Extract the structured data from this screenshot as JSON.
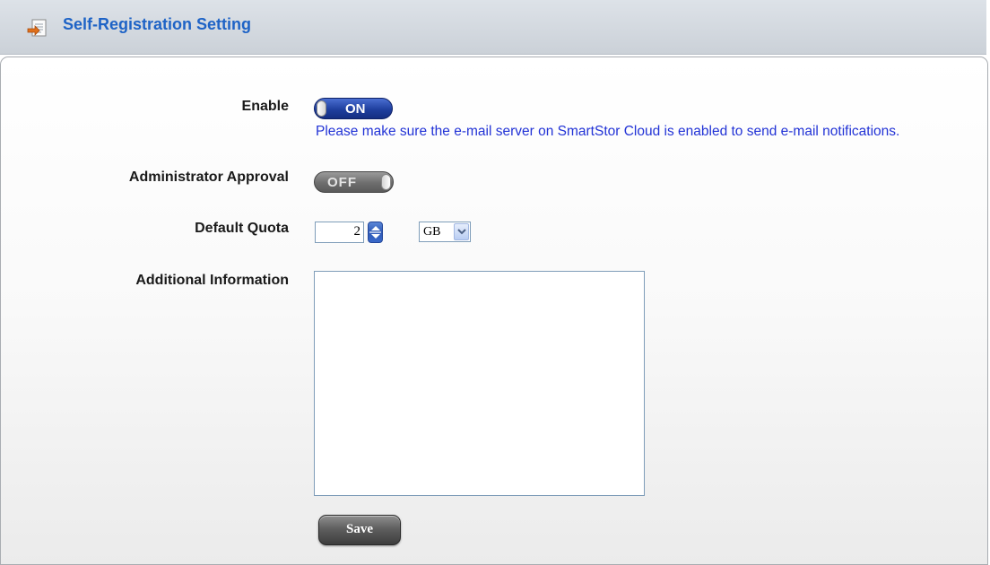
{
  "header": {
    "title": "Self-Registration Setting",
    "icon": "document-edit-icon"
  },
  "form": {
    "enable": {
      "label": "Enable",
      "state": "ON",
      "notice": "Please make sure the e-mail server on SmartStor Cloud is enabled to send e-mail notifications."
    },
    "admin_approval": {
      "label": "Administrator Approval",
      "state": "OFF"
    },
    "default_quota": {
      "label": "Default Quota",
      "value": "2",
      "unit": "GB"
    },
    "additional_info": {
      "label": "Additional Information",
      "value": ""
    },
    "save_label": "Save"
  },
  "colors": {
    "title": "#1e63c6",
    "notice": "#2233d6",
    "toggle_on": "#1f3f9e",
    "toggle_off": "#6e6e6e"
  }
}
